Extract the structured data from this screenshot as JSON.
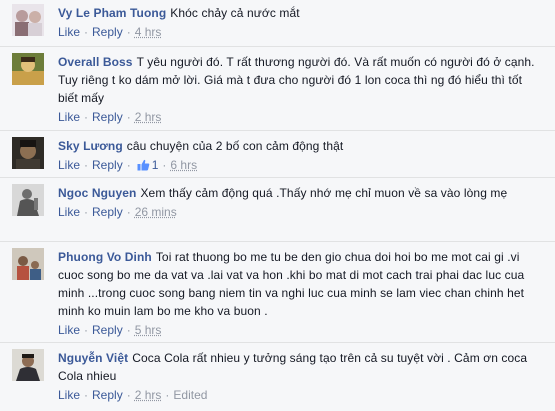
{
  "actions": {
    "like": "Like",
    "reply": "Reply",
    "separator": "·"
  },
  "comments": [
    {
      "author": "Vy Le Pham Tuong",
      "text": "Khóc chảy cả nước mắt",
      "time": "4 hrs",
      "likes": "",
      "edited": ""
    },
    {
      "author": "Overall Boss",
      "text": "T yêu người đó. T rất thương người đó. Và rất muốn có người đó ở cạnh. Tuy riêng t ko dám mở lời. Giá mà t đưa cho người đó 1 lon coca thì ng đó hiểu thì tốt biết mấy",
      "time": "2 hrs",
      "likes": "",
      "edited": ""
    },
    {
      "author": "Sky Lương",
      "text": "câu chuyện của 2 bố con cảm động thật",
      "time": "6 hrs",
      "likes": "1",
      "edited": ""
    },
    {
      "author": "Ngoc Nguyen",
      "text": "Xem thấy cảm động quá .Thấy nhớ mẹ chỉ muon về sa vào lòng mẹ",
      "time": "26 mins",
      "likes": "",
      "edited": ""
    },
    {
      "author": "Phuong Vo Dinh",
      "text": "Toi rat thuong bo me tu be den gio chua doi hoi bo me mot cai gi .vi cuoc song bo me da vat va .lai vat va hon .khi bo mat di mot cach trai phai dac luc cua minh ...trong cuoc song bang niem tin va nghi luc cua minh se lam viec chan chinh het minh ko muin lam bo me kho va buon .",
      "time": "5 hrs",
      "likes": "",
      "edited": ""
    },
    {
      "author": "Nguyễn Việt",
      "text": "Coca Cola rất nhieu y tưởng sáng tạo trên cả su tuyệt vời . Cảm ơn coca Cola nhieu",
      "time": "2 hrs",
      "likes": "",
      "edited": "Edited"
    }
  ],
  "colors": {
    "link": "#3b5998",
    "muted": "#9197a3",
    "text": "#141823",
    "background": "#f6f7f9"
  }
}
